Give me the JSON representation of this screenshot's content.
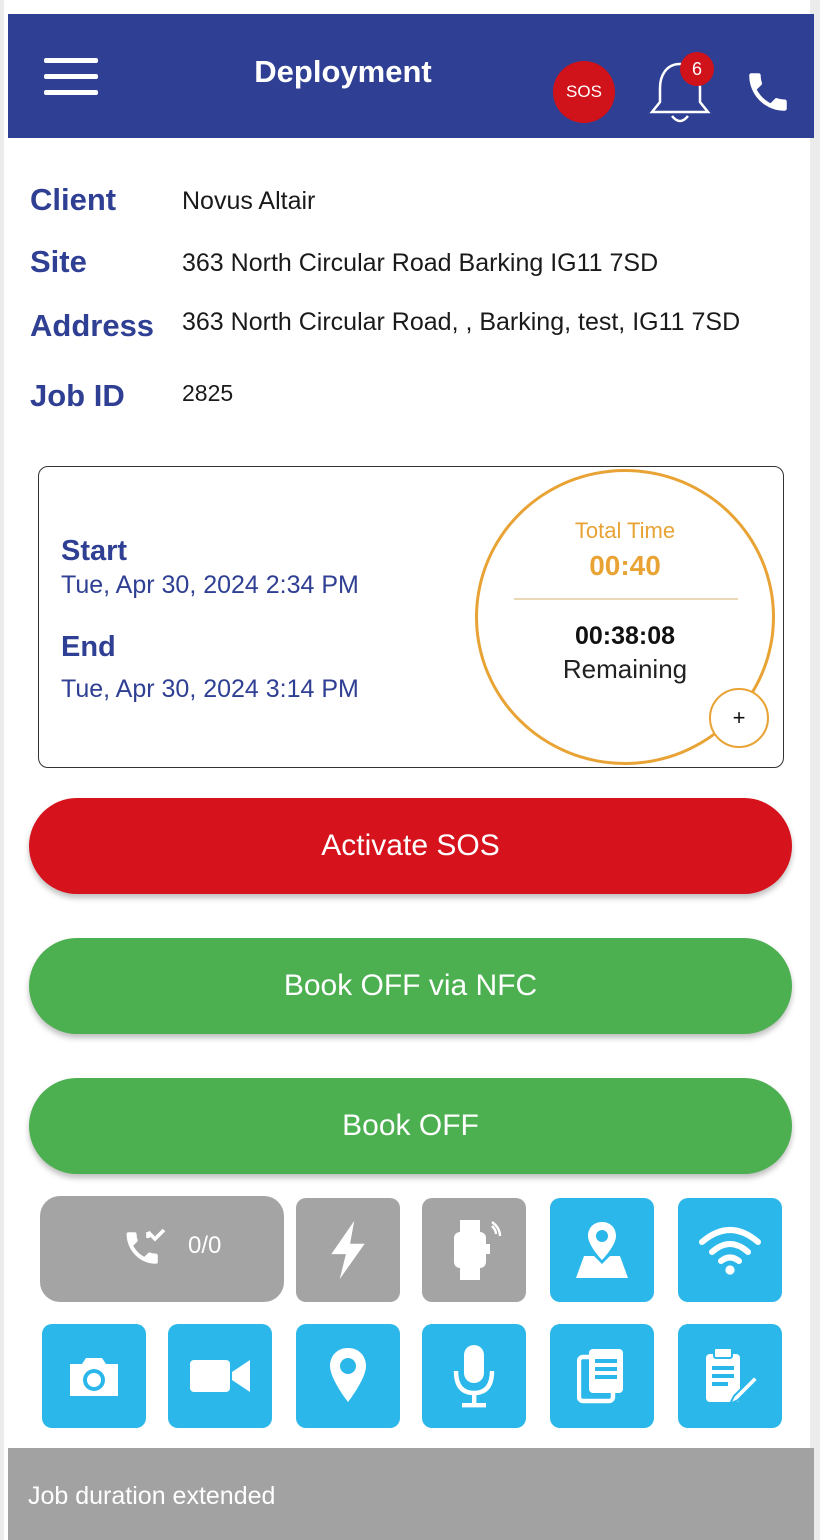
{
  "header": {
    "title": "Deployment",
    "sos_label": "SOS",
    "notification_count": "6",
    "menu_icon": "hamburger-menu-icon",
    "bell_icon": "bell-icon",
    "phone_icon": "phone-icon"
  },
  "details": [
    {
      "label": "Client",
      "value": "Novus Altair"
    },
    {
      "label": "Site",
      "value": "363 North Circular Road Barking IG11 7SD"
    },
    {
      "label": "Address",
      "value": "363 North Circular Road, , Barking, test, IG11 7SD"
    },
    {
      "label": "Job ID",
      "value": "2825"
    }
  ],
  "schedule": {
    "start_label": "Start",
    "start_value": "Tue, Apr 30, 2024 2:34 PM",
    "end_label": "End",
    "end_value": "Tue, Apr 30, 2024 3:14 PM",
    "total_label": "Total Time",
    "total_value": "00:40",
    "remaining_value": "00:38:08",
    "remaining_label": "Remaining",
    "extend_label": "+"
  },
  "actions": {
    "sos": "Activate SOS",
    "book_off_nfc": "Book OFF via NFC",
    "book_off": "Book OFF"
  },
  "tiles": {
    "calls_count": "0/0",
    "row1_icons": [
      "missed-call-icon",
      "flash-icon",
      "smartwatch-icon",
      "map-pin-icon",
      "wifi-icon"
    ],
    "row2_icons": [
      "camera-icon",
      "video-icon",
      "location-icon",
      "microphone-icon",
      "documents-icon",
      "clipboard-edit-icon"
    ]
  },
  "footer": {
    "message": "Job duration extended"
  },
  "colors": {
    "primary": "#2f3f93",
    "sos_red": "#d6121c",
    "green": "#4caf50",
    "tile_blue": "#2bb7ea",
    "tile_gray": "#a4a4a4",
    "accent_orange": "#e8a334"
  }
}
